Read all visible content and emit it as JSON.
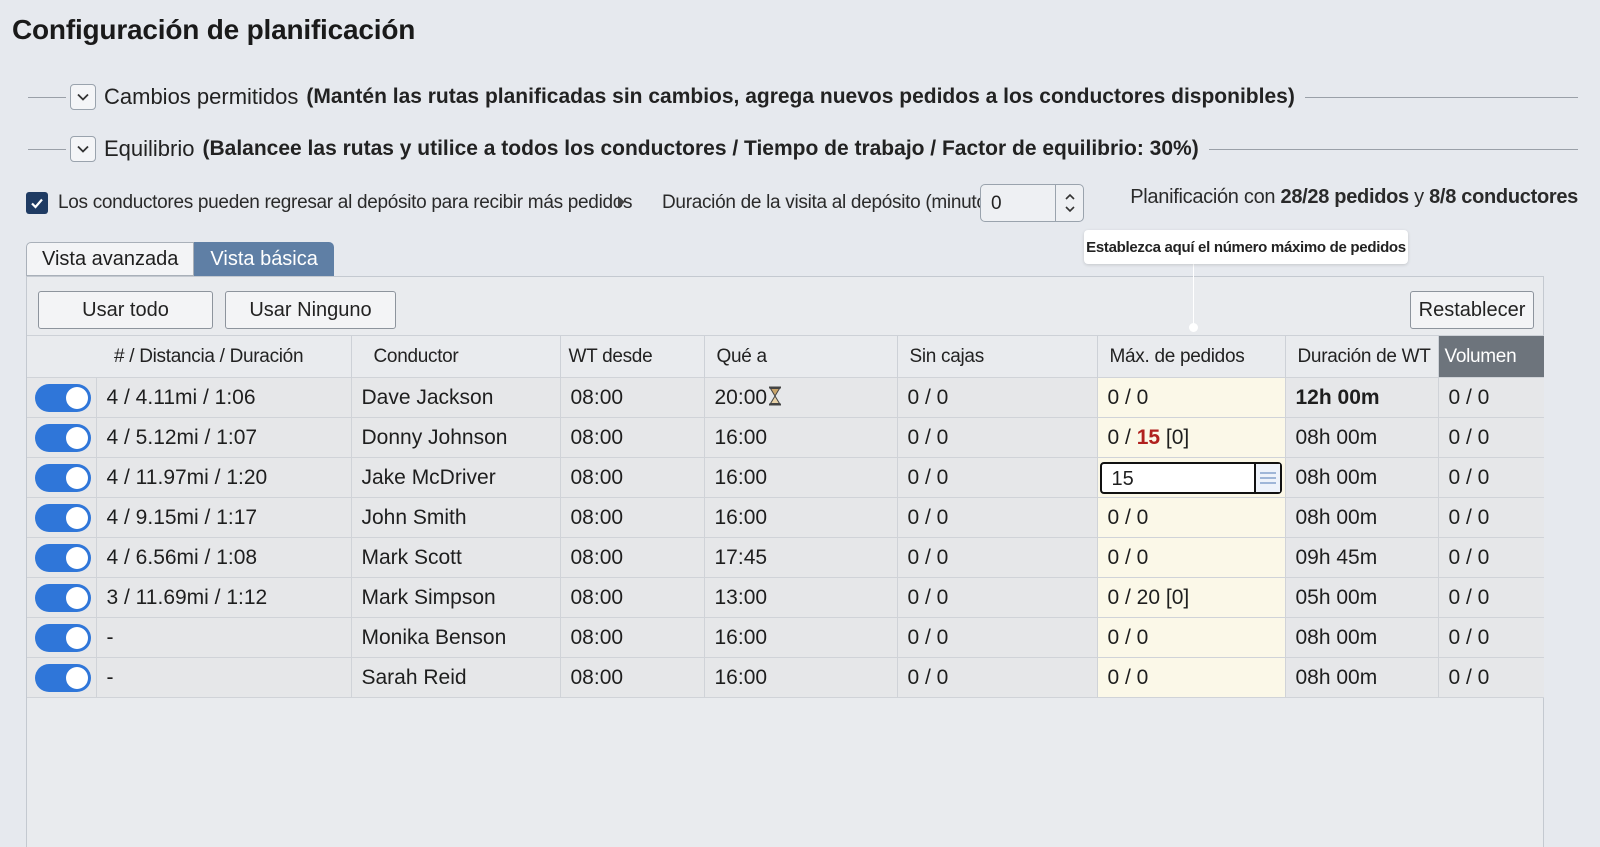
{
  "page_title": "Configuración de planificación",
  "sections": [
    {
      "name": "Cambios permitidos",
      "description": "(Mantén las rutas planificadas sin cambios, agrega nuevos pedidos a los conductores disponibles)"
    },
    {
      "name": "Equilibrio",
      "description": "(Balancee las rutas y utilice a todos los conductores / Tiempo de trabajo / Factor de equilibrio: 30%)"
    }
  ],
  "options": {
    "return_to_depot_checked": true,
    "return_to_depot_label": "Los conductores pueden regresar al depósito para recibir más pedidos",
    "depot_visit_label": "Duración de la visita al depósito (minutos):",
    "depot_visit_value": "0"
  },
  "summary": {
    "prefix": "Planificación con ",
    "orders": "28/28 pedidos",
    "joiner": " y ",
    "drivers": "8/8 conductores"
  },
  "tooltip": "Establezca aquí el número máximo de pedidos",
  "tabs": [
    {
      "label": "Vista avanzada",
      "active": false
    },
    {
      "label": "Vista básica",
      "active": true
    }
  ],
  "buttons": {
    "use_all": "Usar todo",
    "use_none": "Usar Ninguno",
    "reset": "Restablecer"
  },
  "columns": [
    "# / Distancia / Duración",
    "Conductor",
    "WT desde",
    "Qué a",
    "Sin cajas",
    "Máx. de pedidos",
    "Duración de WT",
    "Volumen"
  ],
  "rows": [
    {
      "enabled": true,
      "stats": "4 / 4.11mi / 1:06",
      "driver": "Dave Jackson",
      "wt_from": "08:00",
      "wt_to": "20:00",
      "boxes": "0 / 0",
      "max_orders": "0 / 0",
      "wt_duration": "12h 00m",
      "volume": "0 / 0"
    },
    {
      "enabled": true,
      "stats": "4 / 5.12mi / 1:07",
      "driver": "Donny Johnson",
      "wt_from": "08:00",
      "wt_to": "16:00",
      "boxes": "0 / 0",
      "max_orders": "0 / 15 [0]",
      "wt_duration": "08h 00m",
      "volume": "0 / 0"
    },
    {
      "enabled": true,
      "stats": "4 / 11.97mi / 1:20",
      "driver": "Jake McDriver",
      "wt_from": "08:00",
      "wt_to": "16:00",
      "boxes": "0 / 0",
      "max_orders": "15",
      "wt_duration": "08h 00m",
      "volume": "0 / 0"
    },
    {
      "enabled": true,
      "stats": "4 / 9.15mi / 1:17",
      "driver": "John Smith",
      "wt_from": "08:00",
      "wt_to": "16:00",
      "boxes": "0 / 0",
      "max_orders": "0 / 0",
      "wt_duration": "08h 00m",
      "volume": "0 / 0"
    },
    {
      "enabled": true,
      "stats": "4 / 6.56mi / 1:08",
      "driver": "Mark Scott",
      "wt_from": "08:00",
      "wt_to": "17:45",
      "boxes": "0 / 0",
      "max_orders": "0 / 0",
      "wt_duration": "09h 45m",
      "volume": "0 / 0"
    },
    {
      "enabled": true,
      "stats": "3 / 11.69mi / 1:12",
      "driver": "Mark Simpson",
      "wt_from": "08:00",
      "wt_to": "13:00",
      "boxes": "0 / 0",
      "max_orders": "0 / 20 [0]",
      "wt_duration": "05h 00m",
      "volume": "0 / 0"
    },
    {
      "enabled": true,
      "stats": "-",
      "driver": "Monika Benson",
      "wt_from": "08:00",
      "wt_to": "16:00",
      "boxes": "0 / 0",
      "max_orders": "0 / 0",
      "wt_duration": "08h 00m",
      "volume": "0 / 0"
    },
    {
      "enabled": true,
      "stats": "-",
      "driver": "Sarah Reid",
      "wt_from": "08:00",
      "wt_to": "16:00",
      "boxes": "0 / 0",
      "max_orders": "0 / 0",
      "wt_duration": "08h 00m",
      "volume": "0 / 0"
    }
  ],
  "max_orders_parts": {
    "prefix": "0 / ",
    "value": "15",
    "suffix": " [0]"
  },
  "colors": {
    "accent": "#2f76d9",
    "active_tab": "#5f7fa5",
    "highlight_column": "#fbf8e8",
    "warning": "#b0201e"
  }
}
